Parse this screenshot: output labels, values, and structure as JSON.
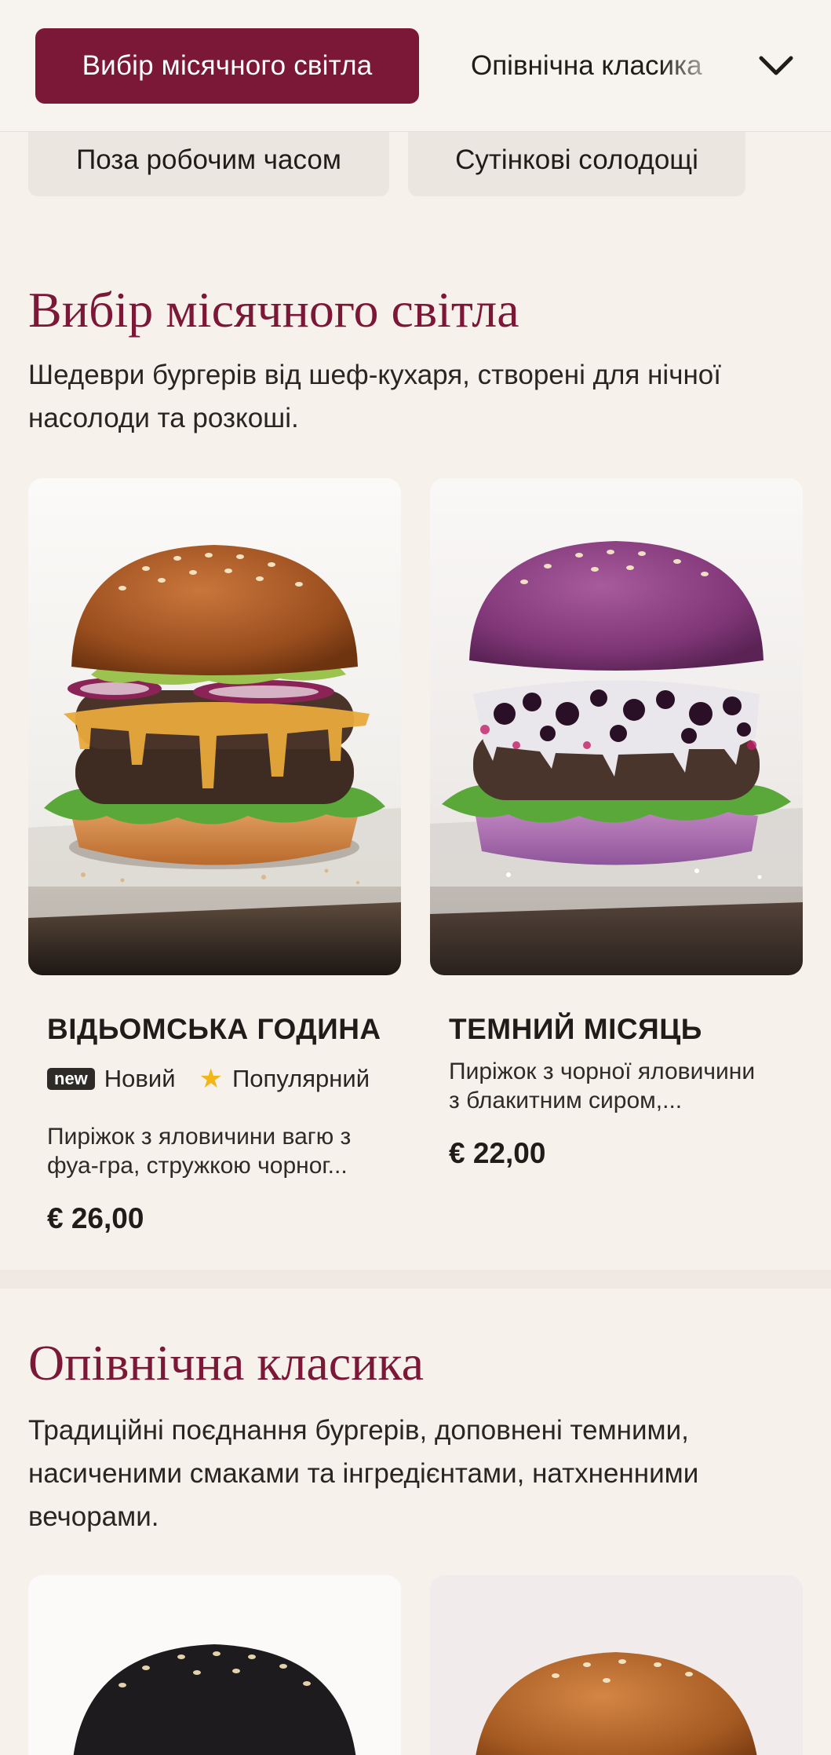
{
  "nav": {
    "active_category": "Вибір місячного світла",
    "next_category": "Опівнічна класика",
    "row2": [
      "Поза робочим часом",
      "Сутінкові солодощі"
    ]
  },
  "sections": [
    {
      "title": "Вибір місячного світла",
      "description": "Шедеври бургерів від шеф-кухаря, створені для нічної насолоди та розкоші.",
      "items": [
        {
          "name": "ВІДЬОМСЬКА ГОДИНА",
          "badge_new_label": "new",
          "badge_new": "Новий",
          "badge_popular": "Популярний",
          "description_line1": "Пиріжок з яловичини вагю з",
          "description_line2": "фуа-гра, стружкою чорног...",
          "price": "€ 26,00"
        },
        {
          "name": "ТЕМНИЙ МІСЯЦЬ",
          "description_line1": "Пиріжок з чорної яловичини",
          "description_line2": "з блакитним сиром,...",
          "price": "€ 22,00"
        }
      ]
    },
    {
      "title": "Опівнічна класика",
      "description": "Традиційні поєднання бургерів, доповнені темними, насиченими смаками та інгредієнтами, натхненними вечорами."
    }
  ],
  "colors": {
    "accent": "#7b1838",
    "background": "#f6f2eb",
    "pill_inactive": "#ece6e0",
    "star": "#f2b619"
  },
  "icons": {
    "toggle": "chevron-down-icon",
    "popular": "star-icon"
  }
}
